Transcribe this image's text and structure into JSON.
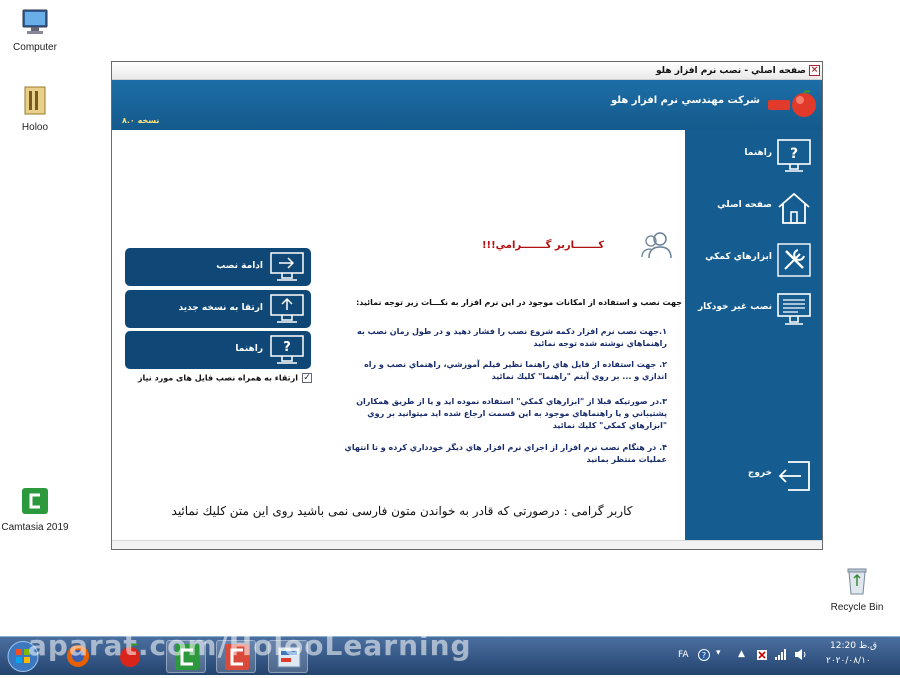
{
  "desktop": {
    "icons": [
      {
        "label": "Computer"
      },
      {
        "label": "Holoo"
      },
      {
        "label": "Camtasia 2019"
      },
      {
        "label": "Recycle Bin"
      }
    ]
  },
  "window": {
    "title": "صفحه اصلي - نصب نرم افزار هلو",
    "close_glyph": "×",
    "company": "شركت مهندسي نرم افزار هلو",
    "version": "نسخه ۸.۰"
  },
  "sidebar": {
    "items": [
      {
        "label": "راهنما",
        "icon": "help-monitor-icon"
      },
      {
        "label": "صفحه اصلي",
        "icon": "home-icon"
      },
      {
        "label": "ابزارهاي كمكي",
        "icon": "tools-icon"
      },
      {
        "label": "نصب غير خودكار",
        "icon": "manual-install-icon"
      },
      {
        "label": "خروج",
        "icon": "exit-icon"
      }
    ]
  },
  "content": {
    "dear_user": "كـــــــاربر گـــــــرامي!!!",
    "intro": "جهت نصب و استفاده از امكانات موجود در اين نرم افزار به نكـــات زير توجه نمائيد:",
    "notes": [
      "۱.جهت نصب نرم افزار دكمه شروع نصب را فشار دهيد و در طول زمان نصب به راهنماهاي نوشته شده توجه نمائيد",
      "۲. جهت استفاده از فايل هاي راهنما نظير فيلم آموزشي، راهنماي نصب و راه اندازي و ... بر روي آيتم \"راهنما\" كليك نمائيد",
      "۳.در صورتيكه قبلا از \"ابزارهاي كمكي\" استفاده نموده ايد و يا از طريق همكاران پشتيباني و يا راهنماهاي موجود به اين قسمت ارجاع شده ايد ميتوانيد بر روي \"ابزارهاي كمكي\" كليك نمائيد",
      "۴. در هنگام نصب نرم افزار از اجراي نرم افزار هاي ديگر خودداري كرده و تا انتهاي عمليات منتظر بمانيد"
    ],
    "buttons": [
      {
        "label": "ادامة نصب",
        "icon": "install-arrow-icon"
      },
      {
        "label": "ارتقا به نسخه جديد",
        "icon": "upgrade-icon"
      },
      {
        "label": "راهنما",
        "icon": "help-icon"
      }
    ],
    "checkbox_label": "ارتقاء به همراه نصب فایل های مورد نیاز",
    "checkbox_checked": true,
    "checkbox_mark": "✓",
    "footer_note": "كاربر گرامی : درصورتی كه قادر به خواندن متون فارسی نمی باشید روی این متن كلیك نمائید"
  },
  "taskbar": {
    "watermark": "aparat.com/HolooLearning",
    "lang": "FA",
    "time": "12:20 ق.ظ",
    "date": "۲۰۲۰/۰۸/۱۰"
  },
  "colors": {
    "banner": "#1a66a0",
    "sidebar": "#155c90",
    "button": "#0f4777",
    "note_text": "#1a2d6b",
    "title_red": "#b01010"
  }
}
